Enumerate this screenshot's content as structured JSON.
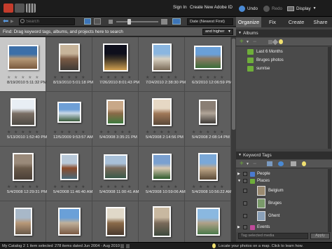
{
  "window": {
    "sign_in": "Sign In",
    "create_id": "Create New Adobe ID",
    "undo": "Undo",
    "redo": "Redo",
    "display": "Display"
  },
  "toolbar": {
    "search_placeholder": "Search",
    "sort": "Date (Newest First)"
  },
  "findbar": {
    "text": "Find: Drag keyword tags, albums, and projects here to search",
    "filter": "and higher"
  },
  "tabs": [
    "Organize",
    "Fix",
    "Create",
    "Share"
  ],
  "panel": {
    "albums_title": "Albums",
    "albums": [
      "Last 6 Months",
      "Bruges photos",
      "sunrise"
    ],
    "keywords_title": "Keyword Tags",
    "tags": [
      {
        "label": "People"
      },
      {
        "label": "Places"
      },
      {
        "label": "Belgium"
      },
      {
        "label": "Bruges"
      },
      {
        "label": "Ghent"
      },
      {
        "label": "Events"
      }
    ],
    "tag_placeholder": "Tag selected media",
    "apply": "Apply"
  },
  "grid": {
    "stars": "★ ★ ★ ★ ★",
    "items": [
      {
        "date": "8/19/2010 5:11:32 PM",
        "colors": [
          "#3c6fa8",
          "#b79a78",
          "#7a5a3e"
        ]
      },
      {
        "date": "8/19/2010 5:01:18 PM",
        "colors": [
          "#c7b49a",
          "#7a5a44",
          "#3e3a36"
        ]
      },
      {
        "date": "7/26/2010 8:01:43 PM",
        "colors": [
          "#0e0f1c",
          "#3b3224",
          "#d0a050"
        ]
      },
      {
        "date": "7/24/2010 2:38:30 PM",
        "colors": [
          "#8ab6e0",
          "#d8d0c0",
          "#7a6a58"
        ]
      },
      {
        "date": "6/3/2010 12:06:59 PM",
        "colors": [
          "#6aa0d8",
          "#8c7a64",
          "#3a6e3a"
        ]
      },
      {
        "date": "5/13/2010 1:52:40 PM",
        "colors": [
          "#e8eef4",
          "#7a6e64",
          "#4e4a44"
        ]
      },
      {
        "date": "12/5/2009 9:53:57 AM",
        "colors": [
          "#6e9fd6",
          "#c8d8e8",
          "#3a5a3a"
        ]
      },
      {
        "date": "5/4/2008 3:35:21 PM",
        "colors": [
          "#c8a888",
          "#8a6a48",
          "#3e7a3e"
        ]
      },
      {
        "date": "5/4/2008 2:14:56 PM",
        "colors": [
          "#e6d8c4",
          "#a07858",
          "#5a4838"
        ]
      },
      {
        "date": "5/4/2008 2:08:14 PM",
        "colors": [
          "#8a7e74",
          "#b0a498",
          "#3e3a36"
        ]
      },
      {
        "date": "5/4/2008 12:29:31 PM",
        "colors": [
          "#9a8a7a",
          "#6a5a4a",
          "#4a4038"
        ]
      },
      {
        "date": "5/4/2008 11:46:40 AM",
        "colors": [
          "#b8c8d8",
          "#8a4a2a",
          "#4a6a7a"
        ]
      },
      {
        "date": "5/4/2008 11:00:41 AM",
        "colors": [
          "#a8c0d8",
          "#7a6a5a",
          "#3a5a4a"
        ]
      },
      {
        "date": "5/4/2008 10:59:06 AM",
        "colors": [
          "#7aa0d0",
          "#d8c8b0",
          "#2e5a2e"
        ]
      },
      {
        "date": "5/4/2008 10:56:22 AM",
        "colors": [
          "#7aa8d8",
          "#c0a888",
          "#5a4a38"
        ]
      },
      {
        "date": "",
        "colors": [
          "#a8b8c8",
          "#b89878",
          "#6a5a4a"
        ]
      },
      {
        "date": "",
        "colors": [
          "#6aa0d8",
          "#c0b09a",
          "#7a5a44"
        ]
      },
      {
        "date": "",
        "colors": [
          "#e0d8c8",
          "#8a6a4a",
          "#4a3a2e"
        ]
      },
      {
        "date": "",
        "colors": [
          "#c8b8a0",
          "#7a6a5a",
          "#3e4a3e"
        ]
      },
      {
        "date": "",
        "colors": [
          "#8ab8e0",
          "#b0a088",
          "#4a7a4a"
        ]
      }
    ]
  },
  "status": {
    "catalog": "My Catalog 2",
    "selected": "1 item selected",
    "dated": "278 items dated Jun 2004 - Aug 2010",
    "tip": "Locate your photos on a map. Click to learn how."
  },
  "colors": {
    "accent_green": "#6fae3a",
    "tab_active": "#5a5a5a",
    "undo_blue": "#4a8ad4"
  }
}
